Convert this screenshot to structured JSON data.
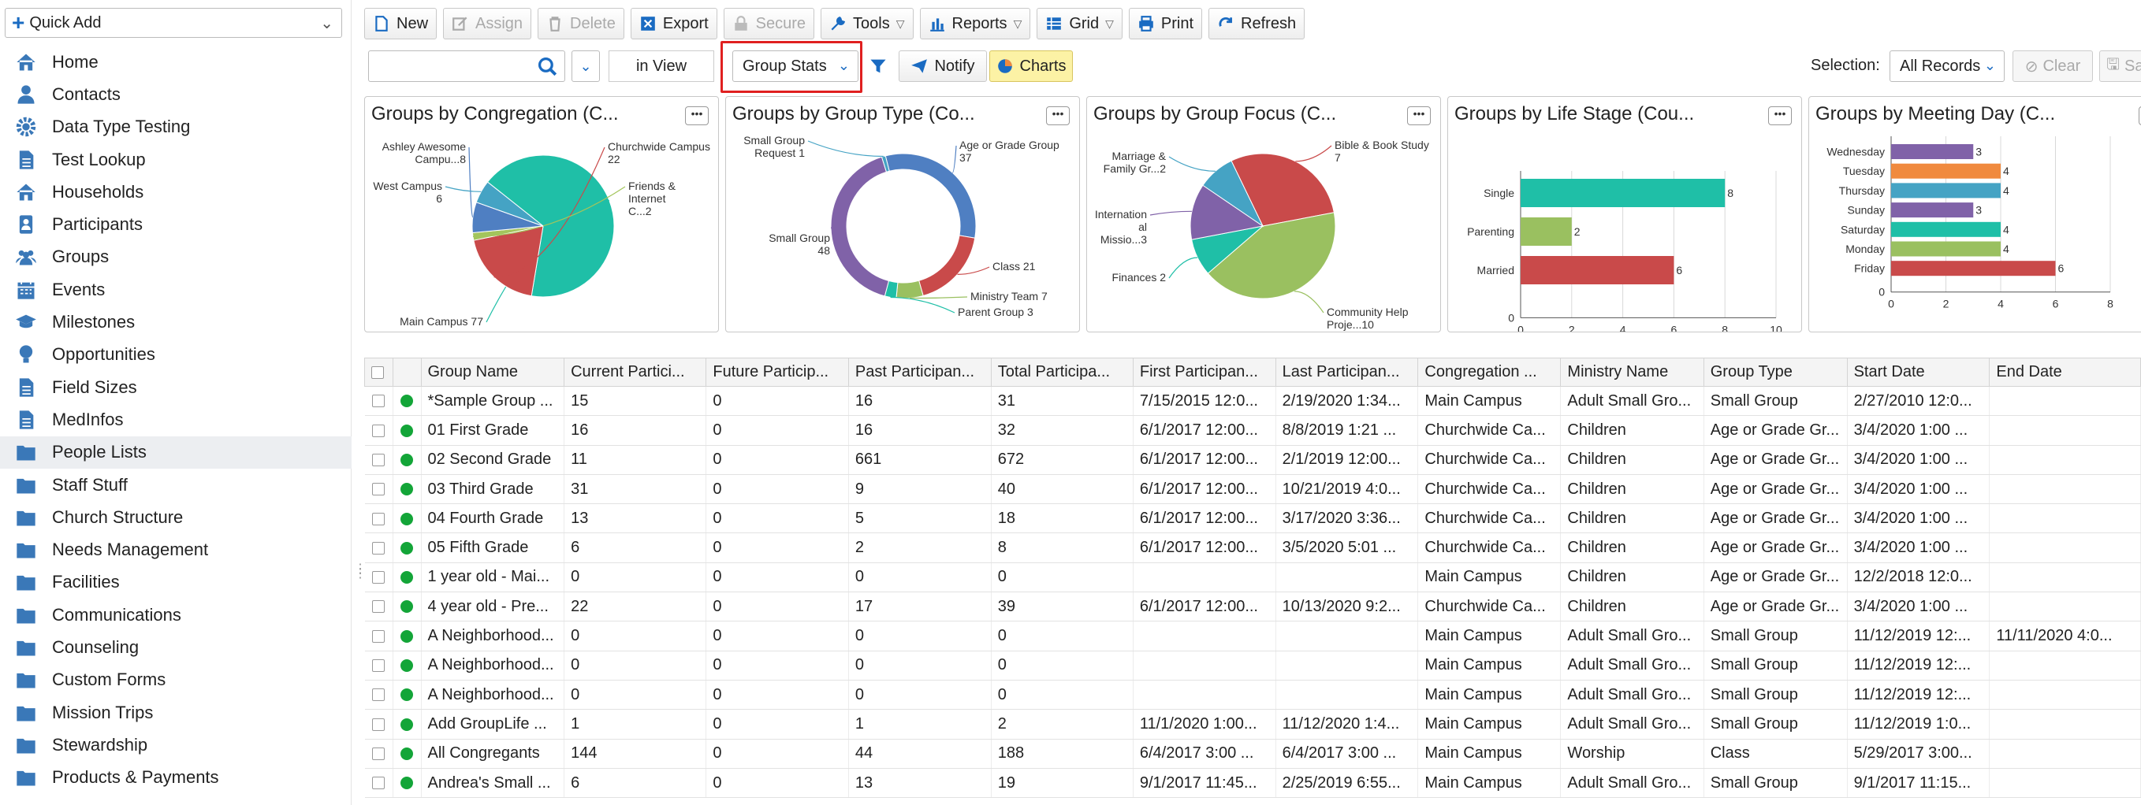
{
  "quick_add": {
    "label": "Quick Add"
  },
  "sidebar": {
    "items": [
      {
        "label": "Home",
        "icon": "home-icon"
      },
      {
        "label": "Contacts",
        "icon": "person-icon"
      },
      {
        "label": "Data Type Testing",
        "icon": "gear-icon"
      },
      {
        "label": "Test Lookup",
        "icon": "document-icon"
      },
      {
        "label": "Households",
        "icon": "home-icon"
      },
      {
        "label": "Participants",
        "icon": "badge-icon"
      },
      {
        "label": "Groups",
        "icon": "people-icon"
      },
      {
        "label": "Events",
        "icon": "calendar-icon"
      },
      {
        "label": "Milestones",
        "icon": "graduation-cap-icon"
      },
      {
        "label": "Opportunities",
        "icon": "lightbulb-icon"
      },
      {
        "label": "Field Sizes",
        "icon": "document-icon"
      },
      {
        "label": "MedInfos",
        "icon": "document-icon"
      },
      {
        "label": "People Lists",
        "icon": "folder-icon"
      },
      {
        "label": "Staff Stuff",
        "icon": "folder-icon"
      },
      {
        "label": "Church Structure",
        "icon": "folder-icon"
      },
      {
        "label": "Needs Management",
        "icon": "folder-icon"
      },
      {
        "label": "Facilities",
        "icon": "folder-icon"
      },
      {
        "label": "Communications",
        "icon": "folder-icon"
      },
      {
        "label": "Counseling",
        "icon": "folder-icon"
      },
      {
        "label": "Custom Forms",
        "icon": "folder-icon"
      },
      {
        "label": "Mission Trips",
        "icon": "folder-icon"
      },
      {
        "label": "Stewardship",
        "icon": "folder-icon"
      },
      {
        "label": "Products & Payments",
        "icon": "folder-icon"
      }
    ],
    "active": "People Lists"
  },
  "toolbar": {
    "new": "New",
    "assign": "Assign",
    "delete": "Delete",
    "export": "Export",
    "secure": "Secure",
    "tools": "Tools",
    "reports": "Reports",
    "grid": "Grid",
    "print": "Print",
    "refresh": "Refresh"
  },
  "filterbar": {
    "search_value": "",
    "in_view": "in View",
    "stats_select": "Group Stats",
    "notify": "Notify",
    "charts": "Charts",
    "selection_label": "Selection:",
    "selection_value": "All Records",
    "clear": "Clear",
    "save": "Sav"
  },
  "colors": {
    "accent": "#1a6bc2",
    "highlight": "#e02020",
    "charts_bg": "#fcf2a5",
    "status_active": "#13a538"
  },
  "chart_data": [
    {
      "type": "pie",
      "title": "Groups by Congregation (C...",
      "slices": [
        {
          "label": "Main Campus 77",
          "value": 77,
          "color": "#1fbfa7"
        },
        {
          "label": "Churchwide Campus 22",
          "value": 22,
          "color": "#c94a4a"
        },
        {
          "label": "Friends & Internet C...2",
          "value": 2,
          "color": "#a3c55c"
        },
        {
          "label": "Ashley Awesome Campu...8",
          "value": 8,
          "color": "#4f7fc2"
        },
        {
          "label": "West Campus 6",
          "value": 6,
          "color": "#45a3c4"
        }
      ]
    },
    {
      "type": "pie",
      "title": "Groups by Group Type (Co...",
      "donut": true,
      "slices": [
        {
          "label": "Age or Grade Group 37",
          "value": 37,
          "color": "#4f7fc2"
        },
        {
          "label": "Class 21",
          "value": 21,
          "color": "#c94a4a"
        },
        {
          "label": "Ministry Team 7",
          "value": 7,
          "color": "#9ac060"
        },
        {
          "label": "Parent Group 3",
          "value": 3,
          "color": "#1fbfa7"
        },
        {
          "label": "Small Group 48",
          "value": 48,
          "color": "#8062a8"
        },
        {
          "label": "Small Group Request 1",
          "value": 1,
          "color": "#45a3c4"
        }
      ]
    },
    {
      "type": "pie",
      "title": "Groups by Group Focus (C...",
      "slices": [
        {
          "label": "Bible & Book Study 7",
          "value": 7,
          "color": "#c94a4a"
        },
        {
          "label": "Community Help Proje...10",
          "value": 10,
          "color": "#9ac060"
        },
        {
          "label": "Finances 2",
          "value": 2,
          "color": "#1fbfa7"
        },
        {
          "label": "Internation al Missio...3",
          "value": 3,
          "color": "#8062a8"
        },
        {
          "label": "Marriage & Family Gr...2",
          "value": 2,
          "color": "#45a3c4"
        }
      ]
    },
    {
      "type": "bar",
      "orientation": "horizontal",
      "title": "Groups by Life Stage (Cou...",
      "categories": [
        "Single",
        "Parenting",
        "Married"
      ],
      "values": [
        8,
        2,
        6
      ],
      "colors": [
        "#1fbfa7",
        "#9ac060",
        "#c94a4a"
      ],
      "xlim": [
        0,
        10
      ],
      "xticks": [
        0,
        2,
        4,
        6,
        8,
        10
      ]
    },
    {
      "type": "bar",
      "orientation": "horizontal",
      "title": "Groups by Meeting Day (C...",
      "categories": [
        "Wednesday",
        "Tuesday",
        "Thursday",
        "Sunday",
        "Saturday",
        "Monday",
        "Friday"
      ],
      "values": [
        3,
        4,
        4,
        3,
        4,
        4,
        6
      ],
      "colors": [
        "#8062a8",
        "#f08a3e",
        "#45a3c4",
        "#8062a8",
        "#1fbfa7",
        "#9ac060",
        "#c94a4a"
      ],
      "xlim": [
        0,
        8
      ],
      "xticks": [
        0,
        2,
        4,
        6,
        8
      ]
    }
  ],
  "table": {
    "columns": [
      "Group Name",
      "Current Partici...",
      "Future Particip...",
      "Past Participan...",
      "Total Participa...",
      "First Participan...",
      "Last Participan...",
      "Congregation ...",
      "Ministry Name",
      "Group Type",
      "Start Date",
      "End Date"
    ],
    "rows": [
      [
        "*Sample Group ...",
        "15",
        "0",
        "16",
        "31",
        "7/15/2015 12:0...",
        "2/19/2020 1:34...",
        "Main Campus",
        "Adult Small Gro...",
        "Small Group",
        "2/27/2010 12:0...",
        ""
      ],
      [
        "01 First Grade",
        "16",
        "0",
        "16",
        "32",
        "6/1/2017 12:00...",
        "8/8/2019 1:21 ...",
        "Churchwide Ca...",
        "Children",
        "Age or Grade Gr...",
        "3/4/2020 1:00 ...",
        ""
      ],
      [
        "02 Second Grade",
        "11",
        "0",
        "661",
        "672",
        "6/1/2017 12:00...",
        "2/1/2019 12:00...",
        "Churchwide Ca...",
        "Children",
        "Age or Grade Gr...",
        "3/4/2020 1:00 ...",
        ""
      ],
      [
        "03 Third Grade",
        "31",
        "0",
        "9",
        "40",
        "6/1/2017 12:00...",
        "10/21/2019 4:0...",
        "Churchwide Ca...",
        "Children",
        "Age or Grade Gr...",
        "3/4/2020 1:00 ...",
        ""
      ],
      [
        "04 Fourth Grade",
        "13",
        "0",
        "5",
        "18",
        "6/1/2017 12:00...",
        "3/17/2020 3:36...",
        "Churchwide Ca...",
        "Children",
        "Age or Grade Gr...",
        "3/4/2020 1:00 ...",
        ""
      ],
      [
        "05 Fifth Grade",
        "6",
        "0",
        "2",
        "8",
        "6/1/2017 12:00...",
        "3/5/2020 5:01 ...",
        "Churchwide Ca...",
        "Children",
        "Age or Grade Gr...",
        "3/4/2020 1:00 ...",
        ""
      ],
      [
        "1 year old - Mai...",
        "0",
        "0",
        "0",
        "0",
        "",
        "",
        "Main Campus",
        "Children",
        "Age or Grade Gr...",
        "12/2/2018 12:0...",
        ""
      ],
      [
        "4 year old - Pre...",
        "22",
        "0",
        "17",
        "39",
        "6/1/2017 12:00...",
        "10/13/2020 9:2...",
        "Churchwide Ca...",
        "Children",
        "Age or Grade Gr...",
        "3/4/2020 1:00 ...",
        ""
      ],
      [
        "A Neighborhood...",
        "0",
        "0",
        "0",
        "0",
        "",
        "",
        "Main Campus",
        "Adult Small Gro...",
        "Small Group",
        "11/12/2019 12:...",
        "11/11/2020 4:0..."
      ],
      [
        "A Neighborhood...",
        "0",
        "0",
        "0",
        "0",
        "",
        "",
        "Main Campus",
        "Adult Small Gro...",
        "Small Group",
        "11/12/2019 12:...",
        ""
      ],
      [
        "A Neighborhood...",
        "0",
        "0",
        "0",
        "0",
        "",
        "",
        "Main Campus",
        "Adult Small Gro...",
        "Small Group",
        "11/12/2019 12:...",
        ""
      ],
      [
        "Add GroupLife ...",
        "1",
        "0",
        "1",
        "2",
        "11/1/2020 1:00...",
        "11/12/2020 1:4...",
        "Main Campus",
        "Adult Small Gro...",
        "Small Group",
        "11/12/2019 1:0...",
        ""
      ],
      [
        "All Congregants",
        "144",
        "0",
        "44",
        "188",
        "6/4/2017 3:00 ...",
        "6/4/2017 3:00 ...",
        "Main Campus",
        "Worship",
        "Class",
        "5/29/2017 3:00...",
        ""
      ],
      [
        "Andrea's Small ...",
        "6",
        "0",
        "13",
        "19",
        "9/1/2017 11:45...",
        "2/25/2019 6:55...",
        "Main Campus",
        "Adult Small Gro...",
        "Small Group",
        "9/1/2017 11:15...",
        ""
      ]
    ]
  }
}
